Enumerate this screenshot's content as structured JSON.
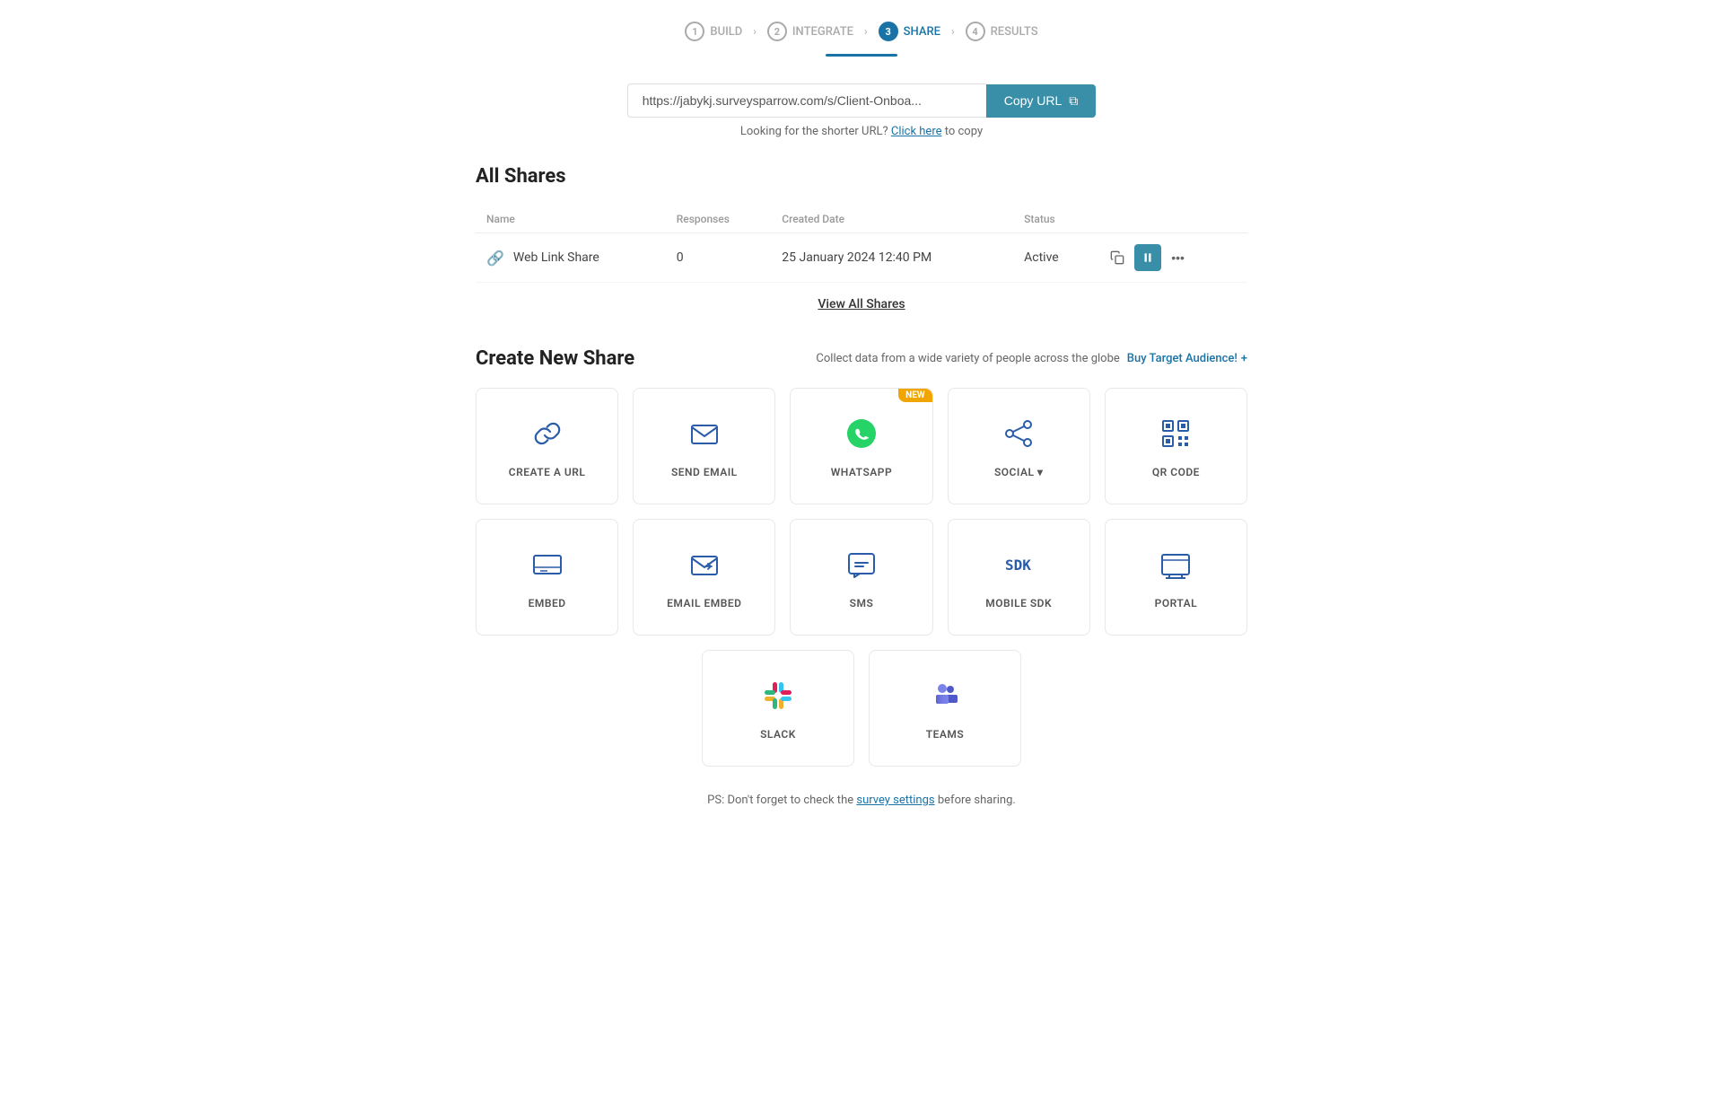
{
  "steps": [
    {
      "number": "1",
      "label": "BUILD",
      "state": "done"
    },
    {
      "number": "2",
      "label": "INTEGRATE",
      "state": "done"
    },
    {
      "number": "3",
      "label": "SHARE",
      "state": "active"
    },
    {
      "number": "4",
      "label": "RESULTS",
      "state": "inactive"
    }
  ],
  "url_section": {
    "url_value": "https://jabykj.surveysparrow.com/s/Client-Onboa...",
    "copy_button_label": "Copy URL",
    "shorter_url_text": "Looking for the shorter URL?",
    "click_here_label": "Click here",
    "to_copy_label": "to copy"
  },
  "all_shares": {
    "title": "All Shares",
    "columns": {
      "name": "Name",
      "responses": "Responses",
      "created_date": "Created Date",
      "status": "Status"
    },
    "rows": [
      {
        "name": "Web Link Share",
        "responses": "0",
        "created_date": "25 January 2024 12:40 PM",
        "status": "Active"
      }
    ],
    "view_all_label": "View All Shares"
  },
  "create_new_share": {
    "title": "Create New Share",
    "collect_text": "Collect data from a wide variety of people across the globe",
    "buy_audience_label": "Buy Target Audience!",
    "cards_row1": [
      {
        "id": "create-url",
        "label": "CREATE A URL",
        "icon": "link",
        "new": false
      },
      {
        "id": "send-email",
        "label": "SEND EMAIL",
        "icon": "email",
        "new": false
      },
      {
        "id": "whatsapp",
        "label": "WHATSAPP",
        "icon": "whatsapp",
        "new": true
      },
      {
        "id": "social",
        "label": "SOCIAL ▾",
        "icon": "social",
        "new": false
      },
      {
        "id": "qr-code",
        "label": "QR CODE",
        "icon": "qrcode",
        "new": false
      }
    ],
    "cards_row2": [
      {
        "id": "embed",
        "label": "EMBED",
        "icon": "embed",
        "new": false
      },
      {
        "id": "email-embed",
        "label": "EMAIL EMBED",
        "icon": "email-embed",
        "new": false
      },
      {
        "id": "sms",
        "label": "SMS",
        "icon": "sms",
        "new": false
      },
      {
        "id": "mobile-sdk",
        "label": "MOBILE SDK",
        "icon": "sdk",
        "new": false
      },
      {
        "id": "portal",
        "label": "PORTAL",
        "icon": "portal",
        "new": false
      }
    ],
    "cards_row3": [
      {
        "id": "slack",
        "label": "SLACK",
        "icon": "slack",
        "new": false
      },
      {
        "id": "teams",
        "label": "TEAMS",
        "icon": "teams",
        "new": false
      }
    ]
  },
  "footer": {
    "note_prefix": "PS: Don't forget to check the",
    "link_label": "survey settings",
    "note_suffix": "before sharing."
  },
  "colors": {
    "primary": "#3a8fa8",
    "accent": "#1a73a7",
    "badge": "#f0a500"
  }
}
